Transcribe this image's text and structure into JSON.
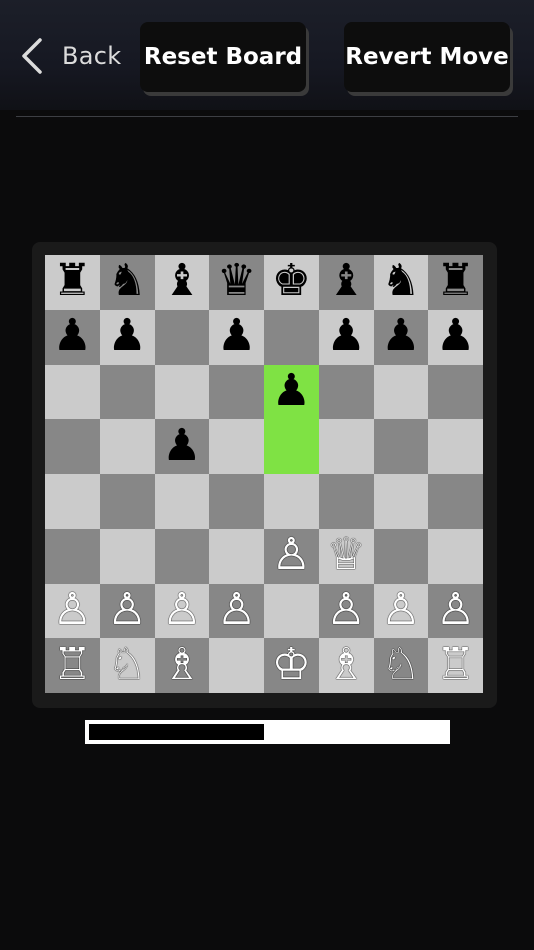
{
  "header": {
    "back_label": "Back",
    "reset_label": "Reset Board",
    "revert_label": "Revert Move"
  },
  "board": {
    "orientation": "white-bottom",
    "colors": {
      "light_square": "#cbcbcb",
      "dark_square": "#878787",
      "highlight_square": "#7fe244"
    },
    "highlighted_squares": [
      "e6",
      "e5"
    ],
    "rows": [
      [
        "br",
        "bn",
        "bb",
        "bq",
        "bk",
        "bb",
        "bn",
        "br"
      ],
      [
        "bp",
        "bp",
        "",
        "bp",
        "",
        "bp",
        "bp",
        "bp"
      ],
      [
        "",
        "",
        "",
        "",
        "bp",
        "",
        "",
        ""
      ],
      [
        "",
        "",
        "bp",
        "",
        "",
        "",
        "",
        ""
      ],
      [
        "",
        "",
        "",
        "",
        "",
        "",
        "",
        ""
      ],
      [
        "",
        "",
        "",
        "",
        "wp",
        "wq",
        "",
        ""
      ],
      [
        "wp",
        "wp",
        "wp",
        "wp",
        "",
        "wp",
        "wp",
        "wp"
      ],
      [
        "wr",
        "wn",
        "wb",
        "",
        "wk",
        "wb",
        "wn",
        "wr"
      ]
    ]
  },
  "eval_bar": {
    "black_fraction": 0.49
  },
  "glyphs": {
    "wk": "♔",
    "wq": "♕",
    "wr": "♖",
    "wb": "♗",
    "wn": "♘",
    "wp": "♙",
    "bk": "♚",
    "bq": "♛",
    "br": "♜",
    "bb": "♝",
    "bn": "♞",
    "bp": "♟"
  },
  "icons": {
    "back": "chevron-left-icon"
  }
}
